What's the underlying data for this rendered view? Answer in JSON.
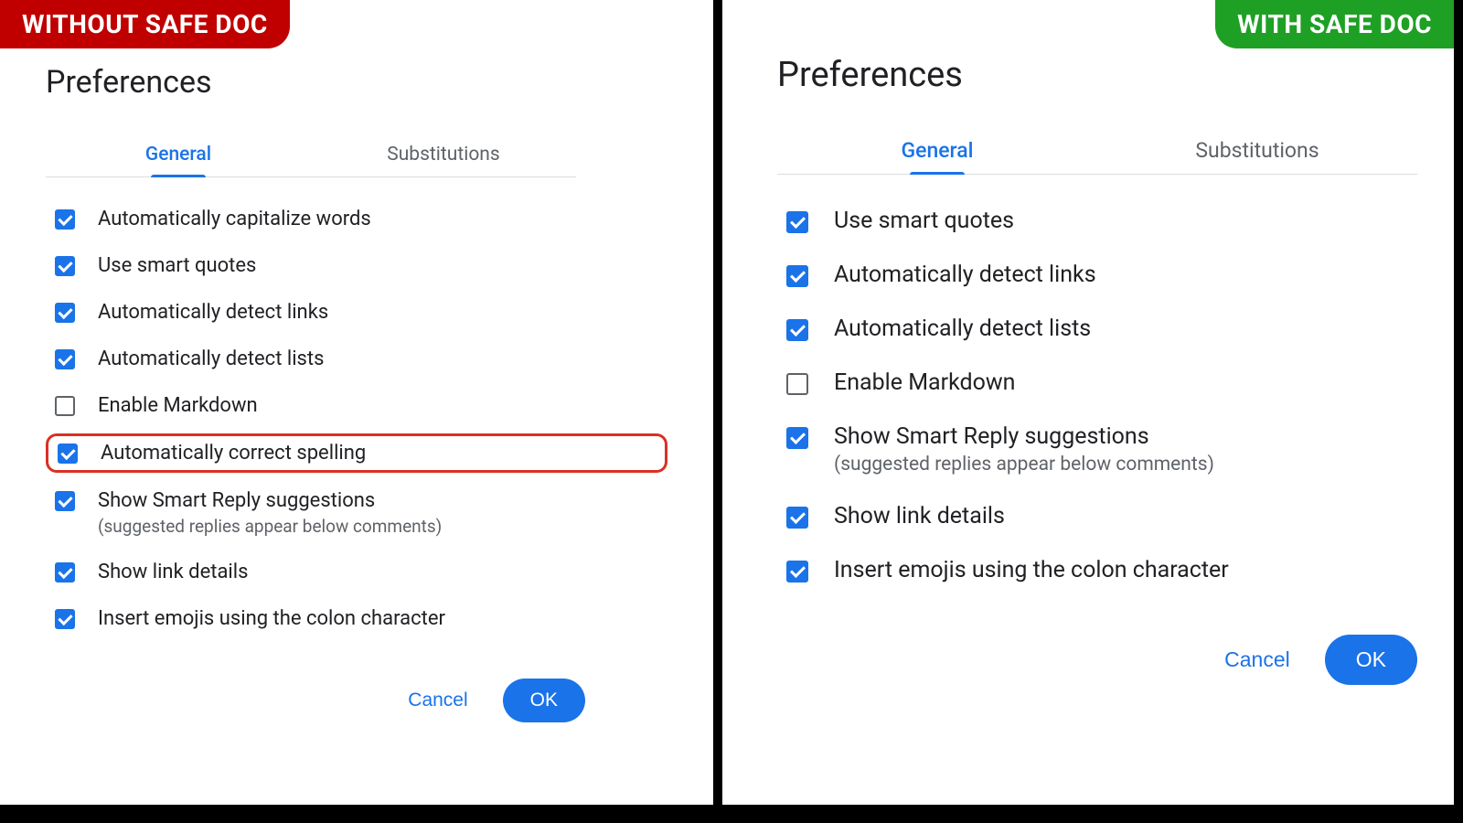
{
  "left": {
    "badge": "WITHOUT SAFE DOC",
    "title": "Preferences",
    "tabs": {
      "general": "General",
      "substitutions": "Substitutions"
    },
    "active_tab": "general",
    "options": [
      {
        "label": "Automatically capitalize words",
        "checked": true,
        "highlighted": false
      },
      {
        "label": "Use smart quotes",
        "checked": true,
        "highlighted": false
      },
      {
        "label": "Automatically detect links",
        "checked": true,
        "highlighted": false
      },
      {
        "label": "Automatically detect lists",
        "checked": true,
        "highlighted": false
      },
      {
        "label": "Enable Markdown",
        "checked": false,
        "highlighted": false
      },
      {
        "label": "Automatically correct spelling",
        "checked": true,
        "highlighted": true
      },
      {
        "label": "Show Smart Reply suggestions",
        "sublabel": "(suggested replies appear below comments)",
        "checked": true,
        "highlighted": false
      },
      {
        "label": "Show link details",
        "checked": true,
        "highlighted": false
      },
      {
        "label": "Insert emojis using the colon character",
        "checked": true,
        "highlighted": false
      }
    ],
    "buttons": {
      "cancel": "Cancel",
      "ok": "OK"
    }
  },
  "right": {
    "badge": "WITH SAFE DOC",
    "title": "Preferences",
    "tabs": {
      "general": "General",
      "substitutions": "Substitutions"
    },
    "active_tab": "general",
    "options": [
      {
        "label": "Use smart quotes",
        "checked": true,
        "highlighted": false
      },
      {
        "label": "Automatically detect links",
        "checked": true,
        "highlighted": false
      },
      {
        "label": "Automatically detect lists",
        "checked": true,
        "highlighted": false
      },
      {
        "label": "Enable Markdown",
        "checked": false,
        "highlighted": false
      },
      {
        "label": "Show Smart Reply suggestions",
        "sublabel": "(suggested replies appear below comments)",
        "checked": true,
        "highlighted": false
      },
      {
        "label": "Show link details",
        "checked": true,
        "highlighted": false
      },
      {
        "label": "Insert emojis using the colon character",
        "checked": true,
        "highlighted": false
      }
    ],
    "buttons": {
      "cancel": "Cancel",
      "ok": "OK"
    }
  }
}
